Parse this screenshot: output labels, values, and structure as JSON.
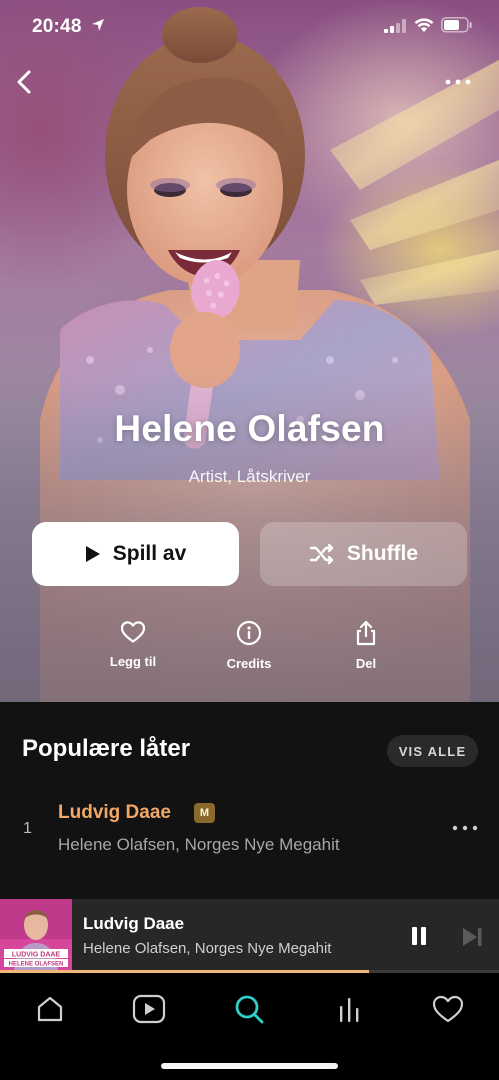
{
  "status_bar": {
    "time": "20:48",
    "icons": [
      "location-arrow-icon",
      "cellular-signal-icon",
      "wifi-icon",
      "battery-icon"
    ]
  },
  "nav": {
    "back_icon": "chevron-left-icon",
    "more_icon": "ellipsis-icon"
  },
  "artist": {
    "name": "Helene Olafsen",
    "roles": "Artist, Låtskriver"
  },
  "buttons": {
    "play_label": "Spill av",
    "shuffle_label": "Shuffle"
  },
  "actions": [
    {
      "label": "Legg til",
      "icon": "heart-outline-icon"
    },
    {
      "label": "Credits",
      "icon": "info-circle-icon"
    },
    {
      "label": "Del",
      "icon": "share-icon"
    }
  ],
  "popular": {
    "title": "Populære låter",
    "see_all_label": "VIS ALLE",
    "tracks": [
      {
        "number": "1",
        "title": "Ludvig Daae",
        "badge": "M",
        "artists": "Helene Olafsen, Norges Nye Megahit"
      }
    ]
  },
  "now_playing": {
    "title": "Ludvig Daae",
    "artists": "Helene Olafsen, Norges Nye Megahit",
    "cover_text_line1": "LUDVIG DAAE",
    "cover_text_line2": "HELENE OLAFSEN",
    "progress": 0.74
  },
  "tab_bar": {
    "tabs": [
      {
        "name": "home",
        "icon": "home-icon",
        "active": false
      },
      {
        "name": "videos",
        "icon": "play-square-icon",
        "active": false
      },
      {
        "name": "search",
        "icon": "search-icon",
        "active": true
      },
      {
        "name": "my-music",
        "icon": "library-bars-icon",
        "active": false
      },
      {
        "name": "favorites",
        "icon": "heart-outline-icon",
        "active": false
      }
    ]
  },
  "colors": {
    "accent_teal": "#2fd0c8",
    "track_title": "#f0a868",
    "progress": "#f0b57a",
    "content_bg": "#121212"
  }
}
